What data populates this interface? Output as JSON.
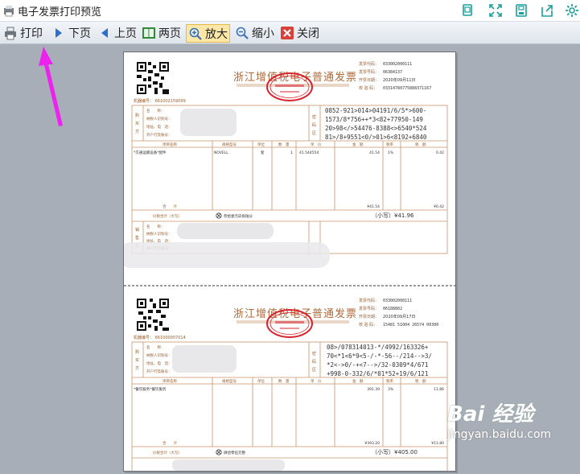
{
  "window": {
    "title": "电子发票打印预览"
  },
  "toolbar": {
    "print": "打印",
    "next": "下页",
    "prev": "上页",
    "two_pages": "两页",
    "zoom_in": "放大",
    "zoom_out": "缩小",
    "close": "关闭"
  },
  "invoice1": {
    "title": "浙江增值税电子普通发票",
    "machine_no": "机器编号： 661002159099",
    "code_label": "发票代码：",
    "code": "033002000111",
    "number_label": "发票号码：",
    "number": "06384137",
    "date_label": "开票日期：",
    "date": "2020年09月11日",
    "check_label": "校 验 码：",
    "check": "03314780775888371167",
    "buyer_labels": [
      "名　　称：",
      "纳税人识别号：",
      "地址、电　话：",
      "开户行及账号："
    ],
    "cipher": [
      "0852-921>014>04191/6/5*>600-",
      "1573/8*756++*3<82+77950-149",
      "20>98</>54476-8388<>6540*524",
      "81>/8+9551<0/>01>6<8192+6840"
    ],
    "headers": [
      "项目名称",
      "规格型号",
      "单位",
      "数　量",
      "单　价",
      "金　额",
      "税率",
      "税　额"
    ],
    "row": [
      "*交通运输设备*配件",
      "NOVELL",
      "套",
      "1",
      "41.544554",
      "41.54",
      "1%",
      "0.42"
    ],
    "sum_label": "合　　计",
    "sum_amount": "¥41.54",
    "sum_tax": "¥0.42",
    "total_label": "价税合计（大写）",
    "total_words": "叁拾壹元玖角陆分",
    "total_small": "（小写）¥41.96",
    "seller_labels": [
      "名　　称：",
      "纳税人识别号：",
      "地址、电　话：",
      "开户行及账号："
    ]
  },
  "invoice2": {
    "title": "浙江增值税电子普通发票",
    "machine_no": "机器编号： 661000007014",
    "code_label": "发票代码：",
    "code": "033002000111",
    "number_label": "发票号码：",
    "number": "06188802",
    "date_label": "开票日期：",
    "date": "2020年09月17日",
    "check_label": "校 验 码：",
    "check": "15481 51004 26574 00300",
    "buyer_labels": [
      "名　　称：",
      "纳税人识别号：",
      "地址、电　话：",
      "开户行及账号："
    ],
    "cipher": [
      "08>/078314013-*/4992/163326+",
      "70<*1<6*9<5-/-*-56--/214-->3/",
      "*2<->0/-+<7-->/32-0309*4/671",
      "+998-0-332/6/*01*52+19/6/121"
    ],
    "headers": [
      "项目名称",
      "规格型号",
      "单位",
      "数　量",
      "单　价",
      "金　额",
      "税率",
      "税　额"
    ],
    "row": [
      "*餐饮服务*餐饮服务",
      "",
      "",
      "",
      "",
      "391.39",
      "3%",
      "11.86"
    ],
    "sum_label": "合　　计",
    "sum_amount": "¥393.20",
    "sum_tax": "¥11.80",
    "total_label": "价税合计（大写）",
    "total_words": "肆佰零伍元整",
    "total_small": "（小写）¥405.00"
  },
  "watermark": {
    "brand": "Bai 经验",
    "url": "jingyan.baidu.com"
  },
  "colors": {
    "toolbar_bg": "#e4e9ef",
    "invoice_line": "#c8956b",
    "invoice_text": "#9a6030",
    "stamp": "#d9232e",
    "annotation_arrow": "#ee22ee",
    "active_button": "#fde7a6"
  },
  "icons": [
    "app-icon",
    "printer-icon",
    "next-arrow-icon",
    "prev-arrow-icon",
    "two-page-icon",
    "zoom-in-icon",
    "zoom-out-icon",
    "close-icon"
  ]
}
